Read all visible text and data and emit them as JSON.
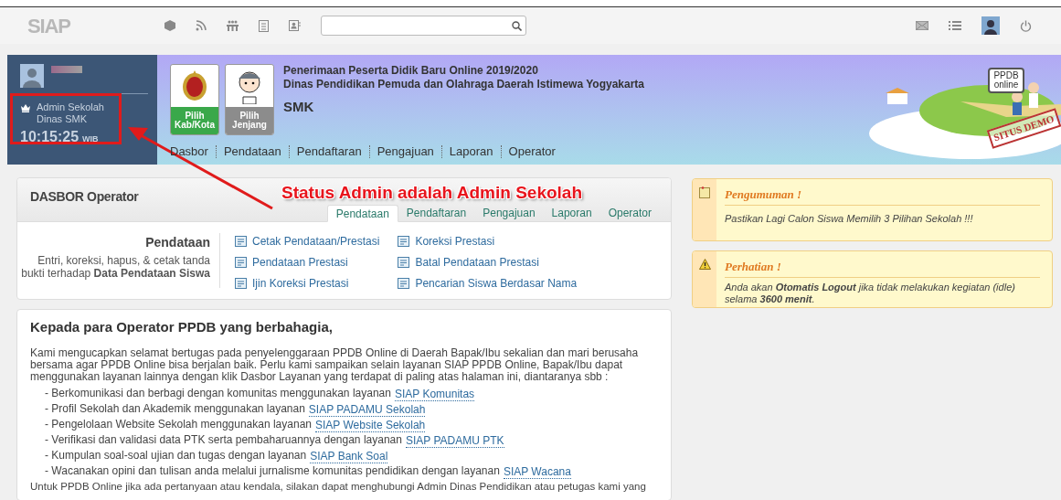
{
  "topbar": {
    "logo": "SIAP"
  },
  "user_panel": {
    "role": "Admin Sekolah",
    "unit": "Dinas SMK",
    "time": "10:15:25",
    "timezone": "WIB"
  },
  "header": {
    "pickers": [
      {
        "label": "Pilih Kab/Kota",
        "color": "#3aa84a"
      },
      {
        "label": "Pilih Jenjang",
        "color": "#8c8c8c"
      }
    ],
    "title_lines": [
      "Penerimaan Peserta Didik Baru Online 2019/2020",
      "Dinas Pendidikan Pemuda dan Olahraga Daerah Istimewa Yogyakarta"
    ],
    "level": "SMK",
    "nav": [
      "Dasbor",
      "Pendataan",
      "Pendaftaran",
      "Pengajuan",
      "Laporan",
      "Operator"
    ],
    "sign": "PPDB online",
    "stamp": "SITUS DEMO"
  },
  "annotation": {
    "text": "Status Admin adalah Admin Sekolah"
  },
  "dashboard": {
    "title": "DASBOR Operator",
    "tabs": [
      {
        "label": "Pendataan",
        "selected": true
      },
      {
        "label": "Pendaftaran",
        "selected": false
      },
      {
        "label": "Pengajuan",
        "selected": false
      },
      {
        "label": "Laporan",
        "selected": false
      },
      {
        "label": "Operator",
        "selected": false
      }
    ],
    "section_title": "Pendataan",
    "section_description": "Entri, koreksi, hapus, & cetak tanda bukti terhadap **Data Pendataan Siswa**",
    "links": [
      [
        "Cetak Pendataan/Prestasi",
        "Pendataan Prestasi",
        "Ijin Koreksi Prestasi"
      ],
      [
        "Koreksi Prestasi",
        "Batal Pendataan Prestasi",
        "Pencarian Siswa Berdasar Nama"
      ]
    ]
  },
  "welcome": {
    "title": "Kepada para Operator PPDB yang berbahagia,",
    "paragraph": "Kami mengucapkan selamat bertugas pada penyelenggaraan PPDB Online di Daerah Bapak/Ibu sekalian dan mari berusaha bersama agar PPDB Online bisa berjalan baik. Perlu kami sampaikan selain layanan SIAP PPDB Online, Bapak/Ibu dapat menggunakan layanan lainnya dengan klik Dasbor Layanan yang terdapat di paling atas halaman ini, diantaranya sbb :",
    "items": [
      {
        "text": "- Berkomunikasi dan berbagi dengan komunitas menggunakan layanan",
        "link": "SIAP Komunitas"
      },
      {
        "text": "- Profil Sekolah dan Akademik menggunakan layanan",
        "link": "SIAP PADAMU Sekolah"
      },
      {
        "text": "- Pengelolaan Website Sekolah menggunakan layanan",
        "link": "SIAP Website Sekolah"
      },
      {
        "text": "- Verifikasi dan validasi data PTK serta pembaharuannya dengan layanan",
        "link": "SIAP PADAMU PTK"
      },
      {
        "text": "- Kumpulan soal-soal ujian dan tugas dengan layanan",
        "link": "SIAP Bank Soal"
      },
      {
        "text": "- Wacanakan opini dan tulisan anda melalui jurnalisme komunitas pendidikan dengan layanan",
        "link": "SIAP Wacana"
      }
    ],
    "closing": "Untuk PPDB Online jika ada pertanyaan atau kendala, silakan dapat menghubungi Admin Dinas Pendidikan atau petugas kami yang"
  },
  "notices": [
    {
      "kind": "note",
      "title": "Pengumuman !",
      "body": "Pastikan Lagi Calon Siswa Memilih 3 Pilihan Sekolah !!!"
    },
    {
      "kind": "warning",
      "title": "Perhatian !",
      "body": "Anda akan **Otomatis Logout** jika tidak melakukan kegiatan (idle) selama **3600 menit**."
    }
  ]
}
